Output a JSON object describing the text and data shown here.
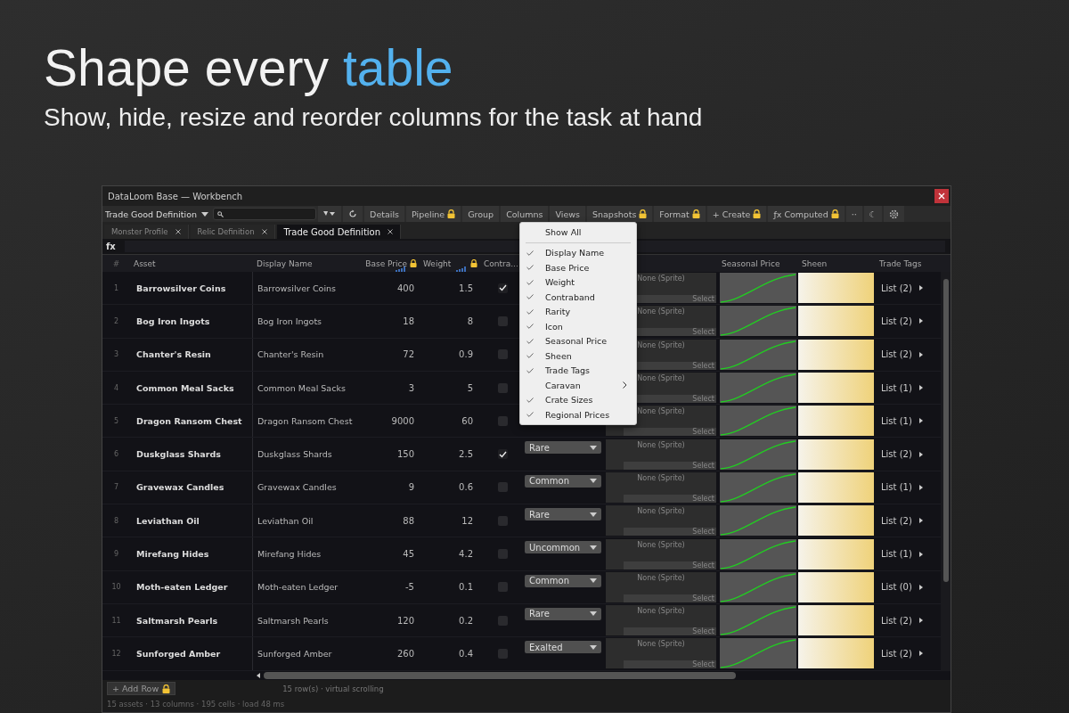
{
  "hero": {
    "title_start": "Shape every ",
    "title_accent": "table",
    "subtitle": "Show, hide, resize and reorder columns for the task at hand"
  },
  "window": {
    "title": "DataLoom Base — Workbench"
  },
  "toolbar": {
    "table_picker": "Trade Good Definition",
    "buttons": [
      {
        "label": "Details"
      },
      {
        "label": "Pipeline",
        "locked": true
      },
      {
        "label": "Group"
      },
      {
        "label": "Columns"
      },
      {
        "label": "Views"
      },
      {
        "label": "Snapshots",
        "locked": true
      },
      {
        "label": "Format",
        "locked": true
      },
      {
        "label": "+ Create",
        "locked": true
      },
      {
        "label": "ƒx Computed",
        "locked": true
      },
      {
        "label": "··"
      },
      {
        "label": "☾"
      }
    ]
  },
  "tabs": [
    {
      "label": "Monster Profile",
      "selected": false
    },
    {
      "label": "Relic Definition",
      "selected": false
    },
    {
      "label": "Trade Good Definition",
      "selected": true
    }
  ],
  "formula_bar": {
    "label": "fx"
  },
  "table": {
    "columns": [
      {
        "label": "#",
        "kind": "index"
      },
      {
        "label": "Asset",
        "kind": "name"
      },
      {
        "label": "Display Name",
        "kind": "text"
      },
      {
        "label": "Base Price",
        "kind": "number",
        "locked": true
      },
      {
        "label": "Weight",
        "kind": "number",
        "locked": true
      },
      {
        "label": "Contra...",
        "kind": "check"
      },
      {
        "kind": "rarity"
      },
      {
        "kind": "icon"
      },
      {
        "label": "Seasonal Price",
        "kind": "curve"
      },
      {
        "label": "Sheen",
        "kind": "gradient"
      },
      {
        "label": "Trade Tags",
        "kind": "list"
      }
    ],
    "rows": [
      {
        "index": "1",
        "asset": "Barrowsilver Coins",
        "display": "Barrowsilver Coins",
        "price": "400",
        "weight": "1.5",
        "contraband": true,
        "icon": "None (Sprite)",
        "icon_button": "Select",
        "tags": "List (2)"
      },
      {
        "index": "2",
        "asset": "Bog Iron Ingots",
        "display": "Bog Iron Ingots",
        "price": "18",
        "weight": "8",
        "contraband": false,
        "icon": "None (Sprite)",
        "icon_button": "Select",
        "tags": "List (2)"
      },
      {
        "index": "3",
        "asset": "Chanter's Resin",
        "display": "Chanter's Resin",
        "price": "72",
        "weight": "0.9",
        "contraband": false,
        "icon": "None (Sprite)",
        "icon_button": "Select",
        "tags": "List (2)"
      },
      {
        "index": "4",
        "asset": "Common Meal Sacks",
        "display": "Common Meal Sacks",
        "price": "3",
        "weight": "5",
        "contraband": false,
        "icon": "None (Sprite)",
        "icon_button": "Select",
        "tags": "List (1)"
      },
      {
        "index": "5",
        "asset": "Dragon Ransom Chest",
        "display": "Dragon Ransom Chest",
        "price": "9000",
        "weight": "60",
        "contraband": false,
        "icon": "None (Sprite)",
        "icon_button": "Select",
        "tags": "List (1)"
      },
      {
        "index": "6",
        "asset": "Duskglass Shards",
        "display": "Duskglass Shards",
        "price": "150",
        "weight": "2.5",
        "contraband": true,
        "rarity": "Rare",
        "icon": "None (Sprite)",
        "icon_button": "Select",
        "tags": "List (2)"
      },
      {
        "index": "7",
        "asset": "Gravewax Candles",
        "display": "Gravewax Candles",
        "price": "9",
        "weight": "0.6",
        "contraband": false,
        "rarity": "Common",
        "icon": "None (Sprite)",
        "icon_button": "Select",
        "tags": "List (1)"
      },
      {
        "index": "8",
        "asset": "Leviathan Oil",
        "display": "Leviathan Oil",
        "price": "88",
        "weight": "12",
        "contraband": false,
        "rarity": "Rare",
        "icon": "None (Sprite)",
        "icon_button": "Select",
        "tags": "List (2)"
      },
      {
        "index": "9",
        "asset": "Mirefang Hides",
        "display": "Mirefang Hides",
        "price": "45",
        "weight": "4.2",
        "contraband": false,
        "rarity": "Uncommon",
        "icon": "None (Sprite)",
        "icon_button": "Select",
        "tags": "List (1)"
      },
      {
        "index": "10",
        "asset": "Moth-eaten Ledger",
        "display": "Moth-eaten Ledger",
        "price": "-5",
        "weight": "0.1",
        "contraband": false,
        "rarity": "Common",
        "icon": "None (Sprite)",
        "icon_button": "Select",
        "tags": "List (0)"
      },
      {
        "index": "11",
        "asset": "Saltmarsh Pearls",
        "display": "Saltmarsh Pearls",
        "price": "120",
        "weight": "0.2",
        "contraband": false,
        "rarity": "Rare",
        "icon": "None (Sprite)",
        "icon_button": "Select",
        "tags": "List (2)"
      },
      {
        "index": "12",
        "asset": "Sunforged Amber",
        "display": "Sunforged Amber",
        "price": "260",
        "weight": "0.4",
        "contraband": false,
        "rarity": "Exalted",
        "icon": "None (Sprite)",
        "icon_button": "Select",
        "tags": "List (2)"
      }
    ]
  },
  "column_menu": {
    "items": [
      {
        "label": "Show All",
        "kind": "action"
      },
      {
        "label": "Display Name",
        "kind": "toggle",
        "checked": true
      },
      {
        "label": "Base Price",
        "kind": "toggle",
        "checked": true
      },
      {
        "label": "Weight",
        "kind": "toggle",
        "checked": true
      },
      {
        "label": "Contraband",
        "kind": "toggle",
        "checked": true
      },
      {
        "label": "Rarity",
        "kind": "toggle",
        "checked": true
      },
      {
        "label": "Icon",
        "kind": "toggle",
        "checked": true
      },
      {
        "label": "Seasonal Price",
        "kind": "toggle",
        "checked": true
      },
      {
        "label": "Sheen",
        "kind": "toggle",
        "checked": true
      },
      {
        "label": "Trade Tags",
        "kind": "toggle",
        "checked": true
      },
      {
        "label": "Caravan",
        "kind": "submenu"
      },
      {
        "label": "Crate Sizes",
        "kind": "toggle",
        "checked": true
      },
      {
        "label": "Regional Prices",
        "kind": "toggle",
        "checked": true
      }
    ]
  },
  "footer": {
    "add_row": "+ Add Row",
    "add_row_locked": true,
    "row_info": "15 row(s) · virtual scrolling",
    "status": "15 assets · 13 columns · 195 cells · load 48 ms"
  }
}
